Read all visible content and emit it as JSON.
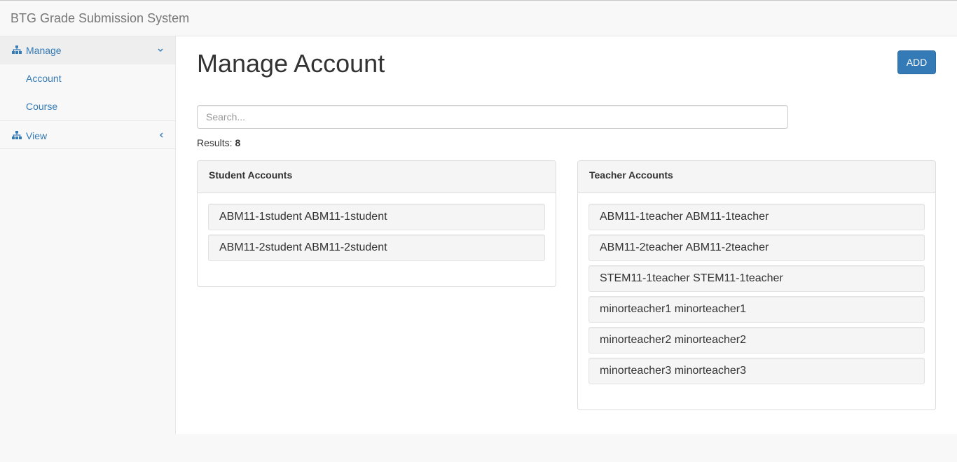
{
  "app": {
    "title": "BTG Grade Submission System"
  },
  "sidebar": {
    "manage": {
      "label": "Manage",
      "icon": "sitemap-icon",
      "chevron": "chevron-down-icon"
    },
    "subitems": [
      {
        "label": "Account"
      },
      {
        "label": "Course"
      }
    ],
    "view": {
      "label": "View",
      "icon": "sitemap-icon",
      "chevron": "chevron-left-icon"
    }
  },
  "main": {
    "title": "Manage Account",
    "add_label": "ADD",
    "search": {
      "placeholder": "Search...",
      "value": ""
    },
    "results": {
      "label": "Results:",
      "count": "8"
    },
    "student_panel": {
      "heading": "Student Accounts",
      "items": [
        "ABM11-1student ABM11-1student",
        "ABM11-2student ABM11-2student"
      ]
    },
    "teacher_panel": {
      "heading": "Teacher Accounts",
      "items": [
        "ABM11-1teacher ABM11-1teacher",
        "ABM11-2teacher ABM11-2teacher",
        "STEM11-1teacher STEM11-1teacher",
        "minorteacher1 minorteacher1",
        "minorteacher2 minorteacher2",
        "minorteacher3 minorteacher3"
      ]
    }
  },
  "colors": {
    "link": "#337ab7",
    "primary": "#337ab7",
    "panel_heading": "#f5f5f5"
  }
}
